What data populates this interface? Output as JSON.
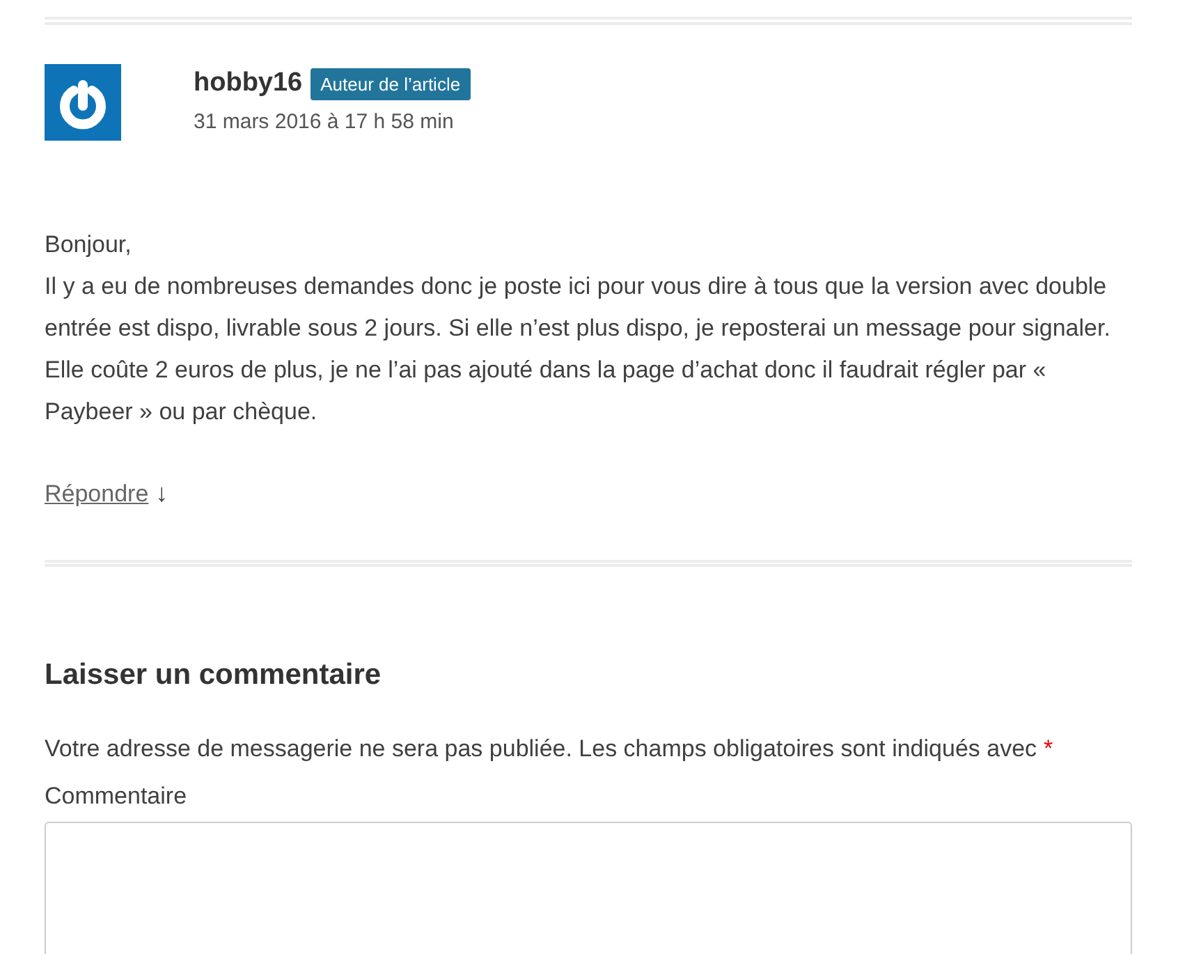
{
  "comment": {
    "author": "hobby16",
    "badge": "Auteur de l’article",
    "date": "31 mars 2016 à 17 h 58 min",
    "lines": [
      "Bonjour,",
      "Il y a eu de nombreuses demandes donc je poste ici pour vous dire à tous que la version avec double entrée est dispo, livrable sous 2 jours. Si elle n’est plus dispo, je reposterai un message pour signaler.",
      "Elle coûte 2 euros de plus, je ne l’ai pas ajouté dans la page d’achat donc il faudrait régler par « Paybeer » ou par chèque."
    ],
    "reply": "Répondre",
    "reply_arrow": "↓"
  },
  "form": {
    "title": "Laisser un commentaire",
    "note": "Votre adresse de messagerie ne sera pas publiée. Les champs obligatoires sont indiqués avec",
    "required_mark": "*",
    "field_label": "Commentaire"
  }
}
